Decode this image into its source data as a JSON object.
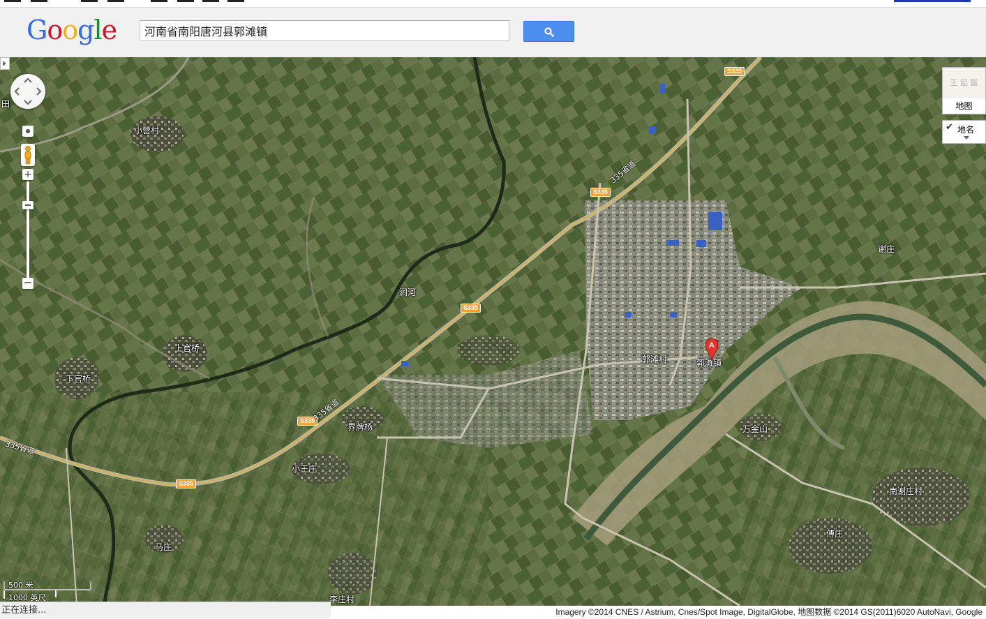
{
  "header": {
    "logo": {
      "letters": [
        "G",
        "o",
        "o",
        "g",
        "l",
        "e"
      ],
      "colors": [
        "#3369e8",
        "#d50f25",
        "#eeb211",
        "#3369e8",
        "#009925",
        "#d50f25"
      ]
    },
    "search_value": "河南省南阳唐河县郭滩镇",
    "search_icon": "search-icon"
  },
  "map_controls": {
    "zoom_in": "+",
    "zoom_out": "−",
    "map_type_thumb": "王 起 鬣",
    "map_type_label": "地图",
    "labels_check": "✔",
    "labels_label": "地名"
  },
  "map_labels": {
    "xiaoying": "小营村",
    "tian": "田",
    "jianhe": "涧河",
    "shangguanqiao": "上官桥",
    "xiaguanqiao": "下官桥",
    "jiepaiyang": "界牌杨",
    "xiaowangzhuang": "小王庄",
    "xiezhuang": "谢庄",
    "guotancun": "郭滩村",
    "guotanzhen": "郭滩镇",
    "wanjinshan": "万金山",
    "nanxiezhuang": "南谢庄村",
    "fuzhuang": "傅庄",
    "mazhuang": "马庄",
    "lizhuang": "李庄村"
  },
  "road_shields": [
    "S335",
    "S335",
    "S335",
    "S335",
    "S335"
  ],
  "road_labels": {
    "r1": "335省道",
    "r2": "335省道",
    "r3": "335省道"
  },
  "marker": {
    "letter": "A",
    "color": "#e0352b"
  },
  "scale": {
    "metric": "500 米",
    "imperial": "1000 英尺"
  },
  "footer": {
    "copyright": "Imagery ©2014 CNES / Astrium, Cnes/Spot Image, DigitalGlobe, 地图数据 ©2014 GS(2011)6020 AutoNavi, Google",
    "status": "正在连接..."
  }
}
